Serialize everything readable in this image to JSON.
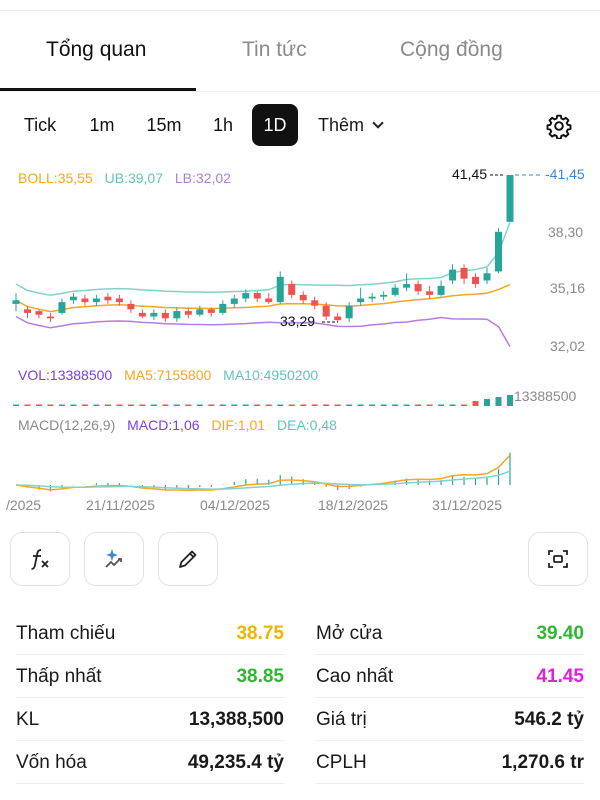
{
  "tabs": [
    {
      "label": "Tổng quan"
    },
    {
      "label": "Tin tức"
    },
    {
      "label": "Cộng đồng"
    }
  ],
  "timeframes": [
    "Tick",
    "1m",
    "15m",
    "1h",
    "1D"
  ],
  "active_timeframe": "1D",
  "more_label": "Thêm",
  "colors": {
    "up": "#26a69a",
    "down": "#ef5350",
    "boll_mid": "#f5a623",
    "boll_upper": "#7fd3cc",
    "boll_lower": "#b67be3",
    "macd": "#7b3fe4",
    "dif": "#f5a623",
    "dea": "#7fd3cc",
    "ref": "#f0b400",
    "green": "#2eb82e",
    "magenta": "#e020e0",
    "price_line": "#3a86d4"
  },
  "indicators": {
    "boll": {
      "label": "BOLL:35,55",
      "ub": "UB:39,07",
      "lb": "LB:32,02"
    },
    "vol": {
      "label": "VOL:13388500",
      "ma5": "MA5:7155800",
      "ma10": "MA10:4950200"
    },
    "macd": {
      "label": "MACD(12,26,9)",
      "macd": "MACD:1,06",
      "dif": "DIF:1,01",
      "dea": "DEA:0,48"
    }
  },
  "price_axis": [
    "41,45",
    "38,30",
    "35,16",
    "32,02"
  ],
  "max_label": "41,45",
  "min_label": "33,29",
  "vol_axis_label": "13388500",
  "date_labels": [
    "/2025",
    "21/11/2025",
    "04/12/2025",
    "18/12/2025",
    "31/12/2025"
  ],
  "chart_data": {
    "type": "candlestick",
    "price_range": [
      32.02,
      41.45
    ],
    "candles": [
      {
        "o": 34.3,
        "c": 34.5,
        "h": 34.9,
        "l": 33.9
      },
      {
        "o": 34.0,
        "c": 33.8,
        "h": 34.2,
        "l": 33.5
      },
      {
        "o": 33.9,
        "c": 33.7,
        "h": 34.0,
        "l": 33.5
      },
      {
        "o": 33.6,
        "c": 33.5,
        "h": 33.8,
        "l": 33.3
      },
      {
        "o": 33.8,
        "c": 34.4,
        "h": 34.6,
        "l": 33.7
      },
      {
        "o": 34.5,
        "c": 34.7,
        "h": 34.9,
        "l": 34.3
      },
      {
        "o": 34.6,
        "c": 34.4,
        "h": 34.8,
        "l": 34.2
      },
      {
        "o": 34.4,
        "c": 34.6,
        "h": 34.8,
        "l": 34.2
      },
      {
        "o": 34.7,
        "c": 34.5,
        "h": 34.9,
        "l": 34.3
      },
      {
        "o": 34.6,
        "c": 34.4,
        "h": 34.8,
        "l": 34.2
      },
      {
        "o": 34.3,
        "c": 34.0,
        "h": 34.5,
        "l": 33.8
      },
      {
        "o": 33.8,
        "c": 33.6,
        "h": 34.0,
        "l": 33.5
      },
      {
        "o": 33.6,
        "c": 33.8,
        "h": 34.0,
        "l": 33.4
      },
      {
        "o": 33.8,
        "c": 33.5,
        "h": 34.0,
        "l": 33.3
      },
      {
        "o": 33.5,
        "c": 33.9,
        "h": 34.1,
        "l": 33.3
      },
      {
        "o": 33.9,
        "c": 33.7,
        "h": 34.1,
        "l": 33.5
      },
      {
        "o": 33.7,
        "c": 34.0,
        "h": 34.2,
        "l": 33.6
      },
      {
        "o": 34.0,
        "c": 33.8,
        "h": 34.1,
        "l": 33.6
      },
      {
        "o": 33.8,
        "c": 34.3,
        "h": 34.5,
        "l": 33.7
      },
      {
        "o": 34.3,
        "c": 34.6,
        "h": 34.8,
        "l": 34.1
      },
      {
        "o": 34.6,
        "c": 34.9,
        "h": 35.1,
        "l": 34.4
      },
      {
        "o": 34.9,
        "c": 34.6,
        "h": 35.0,
        "l": 34.4
      },
      {
        "o": 34.6,
        "c": 34.4,
        "h": 34.9,
        "l": 34.3
      },
      {
        "o": 34.4,
        "c": 35.8,
        "h": 36.1,
        "l": 34.3
      },
      {
        "o": 35.4,
        "c": 34.8,
        "h": 35.6,
        "l": 34.6
      },
      {
        "o": 34.8,
        "c": 34.5,
        "h": 35.0,
        "l": 34.3
      },
      {
        "o": 34.5,
        "c": 34.2,
        "h": 34.7,
        "l": 34.0
      },
      {
        "o": 34.2,
        "c": 33.6,
        "h": 34.4,
        "l": 33.4
      },
      {
        "o": 33.6,
        "c": 33.4,
        "h": 33.8,
        "l": 33.29
      },
      {
        "o": 33.5,
        "c": 34.2,
        "h": 34.4,
        "l": 33.3
      },
      {
        "o": 34.4,
        "c": 34.6,
        "h": 35.2,
        "l": 34.2
      },
      {
        "o": 34.6,
        "c": 34.7,
        "h": 34.9,
        "l": 34.4
      },
      {
        "o": 34.7,
        "c": 34.8,
        "h": 35.0,
        "l": 34.5
      },
      {
        "o": 34.8,
        "c": 35.2,
        "h": 35.4,
        "l": 34.7
      },
      {
        "o": 35.2,
        "c": 35.4,
        "h": 36.0,
        "l": 35.0
      },
      {
        "o": 35.4,
        "c": 35.0,
        "h": 35.6,
        "l": 34.8
      },
      {
        "o": 35.0,
        "c": 34.8,
        "h": 35.3,
        "l": 34.6
      },
      {
        "o": 34.8,
        "c": 35.3,
        "h": 35.6,
        "l": 34.7
      },
      {
        "o": 35.6,
        "c": 36.2,
        "h": 36.5,
        "l": 35.4
      },
      {
        "o": 36.3,
        "c": 35.7,
        "h": 36.5,
        "l": 35.4
      },
      {
        "o": 35.8,
        "c": 35.4,
        "h": 36.0,
        "l": 35.2
      },
      {
        "o": 35.6,
        "c": 36.0,
        "h": 36.3,
        "l": 35.4
      },
      {
        "o": 36.1,
        "c": 38.3,
        "h": 38.5,
        "l": 36.0
      },
      {
        "o": 38.85,
        "c": 41.45,
        "h": 41.45,
        "l": 38.85
      }
    ],
    "volume_last": 13388500
  },
  "stats": {
    "left": [
      {
        "label": "Tham chiếu",
        "value": "38.75",
        "color": "#f0b400"
      },
      {
        "label": "Thấp nhất",
        "value": "38.85",
        "color": "#2eb82e"
      },
      {
        "label": "KL",
        "value": "13,388,500",
        "color": "#111111"
      },
      {
        "label": "Vốn hóa",
        "value": "49,235.4 tỷ",
        "color": "#111111"
      }
    ],
    "right": [
      {
        "label": "Mở cửa",
        "value": "39.40",
        "color": "#2eb82e"
      },
      {
        "label": "Cao nhất",
        "value": "41.45",
        "color": "#e020e0"
      },
      {
        "label": "Giá trị",
        "value": "546.2 tỷ",
        "color": "#111111"
      },
      {
        "label": "CPLH",
        "value": "1,270.6 tr",
        "color": "#111111"
      }
    ]
  },
  "tool_icons": [
    "fx-icon",
    "ai-sparkle-icon",
    "pencil-icon",
    "screenshot-icon"
  ]
}
